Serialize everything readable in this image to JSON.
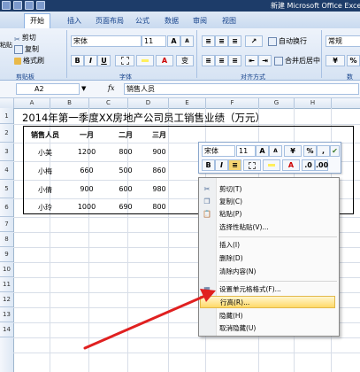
{
  "window": {
    "title": "新建 Microsoft Office Excel 工"
  },
  "tabs": [
    "开始",
    "插入",
    "页面布局",
    "公式",
    "数据",
    "审阅",
    "视图"
  ],
  "ribbon": {
    "clipboard": {
      "cut": "剪切",
      "copy": "复制",
      "format_painter": "格式刷",
      "paste": "粘贴",
      "group_label": "剪贴板"
    },
    "font": {
      "name": "宋体",
      "size": "11",
      "grow": "A",
      "shrink": "A",
      "bold": "B",
      "italic": "I",
      "underline": "U",
      "font_color": "A",
      "phonetic": "变",
      "group_label": "字体"
    },
    "alignment": {
      "wrap": "自动换行",
      "merge": "合并后居中",
      "group_label": "对齐方式"
    },
    "number": {
      "format": "常规",
      "group_label": "数"
    }
  },
  "formula_bar": {
    "cell_ref": "A2",
    "fx": "fx",
    "content": "销售人员"
  },
  "columns": [
    "A",
    "B",
    "C",
    "D",
    "E",
    "F",
    "G",
    "H"
  ],
  "rows": [
    "1",
    "2",
    "3",
    "4",
    "5",
    "6",
    "7",
    "8",
    "9",
    "10",
    "11",
    "12",
    "13",
    "14"
  ],
  "sheet": {
    "title": "2014年第一季度XX房地产公司员工销售业绩（万元）",
    "headers": [
      "销售人员",
      "一月",
      "二月",
      "三月"
    ],
    "data": [
      [
        "小美",
        "1200",
        "800",
        "900"
      ],
      [
        "小梅",
        "660",
        "500",
        "860"
      ],
      [
        "小倩",
        "900",
        "600",
        "980"
      ],
      [
        "小玲",
        "1000",
        "690",
        "800"
      ]
    ]
  },
  "mini_toolbar": {
    "font": "宋体",
    "size": "11",
    "grow": "A",
    "shrink": "A",
    "percent": "%",
    "comma": ",",
    "bold": "B",
    "italic": "I",
    "font_color": "A"
  },
  "context_menu": {
    "items": [
      "剪切(T)",
      "复制(C)",
      "粘贴(P)",
      "选择性粘贴(V)...",
      "插入(I)",
      "删除(D)",
      "清除内容(N)",
      "设置单元格格式(F)...",
      "行高(R)...",
      "隐藏(H)",
      "取消隐藏(U)"
    ]
  },
  "colors": {
    "title_bar": "#1d3c69",
    "highlight": "#ffd967",
    "arrow": "#e02020"
  }
}
